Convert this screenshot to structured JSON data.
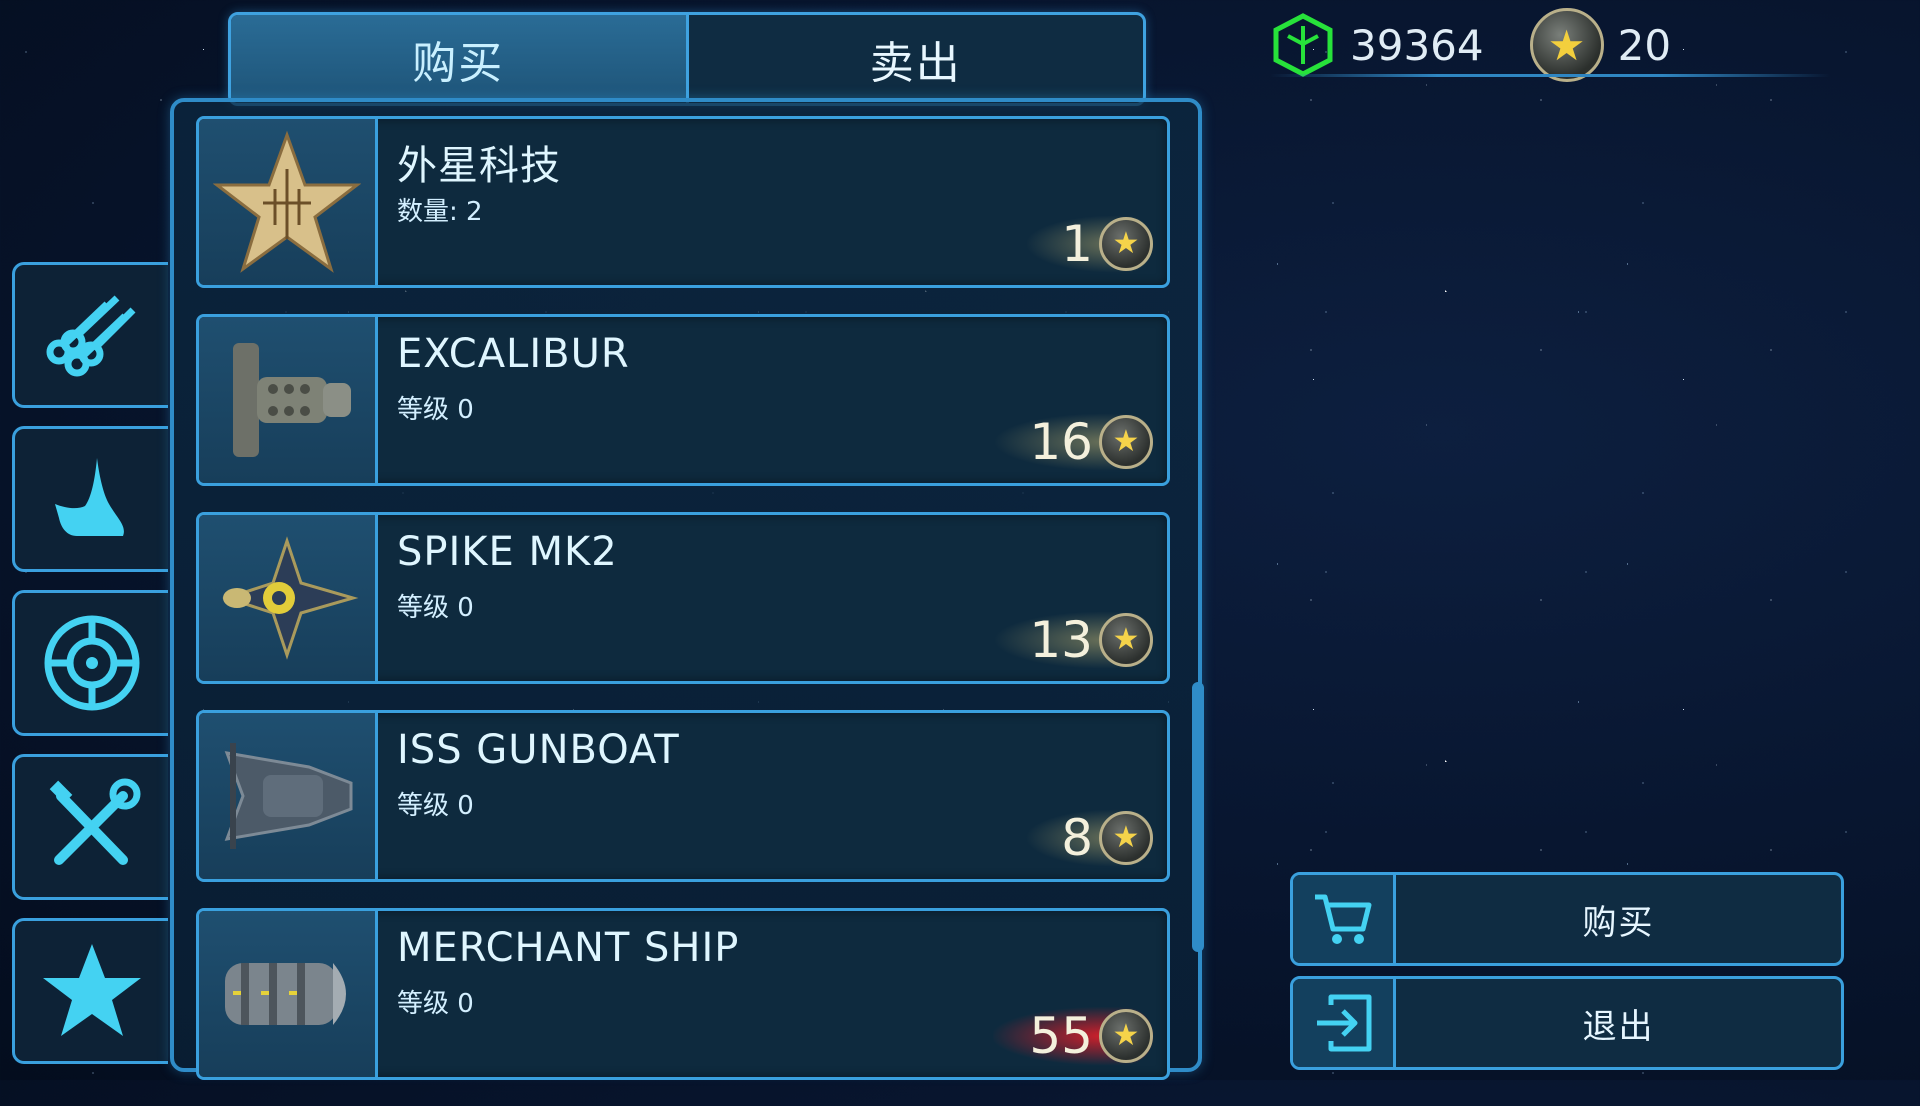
{
  "tabs": {
    "buy": "购买",
    "sell": "卖出"
  },
  "currency": {
    "cubes": "39364",
    "stars": "20"
  },
  "side_menu": [
    {
      "icon": "pipes-icon"
    },
    {
      "icon": "boot-icon"
    },
    {
      "icon": "crosshair-icon"
    },
    {
      "icon": "tools-icon"
    },
    {
      "icon": "star-icon"
    }
  ],
  "items": [
    {
      "name": "外星科技",
      "sub": "数量: 2",
      "price": "1",
      "price_color": "normal",
      "icon": "alien-tech-star-icon"
    },
    {
      "name": "EXCALIBUR",
      "sub": "等级 0",
      "price": "16",
      "price_color": "normal",
      "icon": "excalibur-ship-icon"
    },
    {
      "name": "SPIKE MK2",
      "sub": "等级 0",
      "price": "13",
      "price_color": "normal",
      "icon": "spike-mk2-ship-icon"
    },
    {
      "name": "ISS GUNBOAT",
      "sub": "等级 0",
      "price": "8",
      "price_color": "normal",
      "icon": "gunboat-ship-icon"
    },
    {
      "name": "MERCHANT SHIP",
      "sub": "等级 0",
      "price": "55",
      "price_color": "red",
      "icon": "merchant-ship-icon"
    }
  ],
  "actions": {
    "buy": "购买",
    "exit": "退出"
  },
  "colors": {
    "accent": "#3aa0de",
    "panel": "#0e2a3e",
    "insufficient": "#e01e28",
    "coin_star": "#f5d34a"
  }
}
